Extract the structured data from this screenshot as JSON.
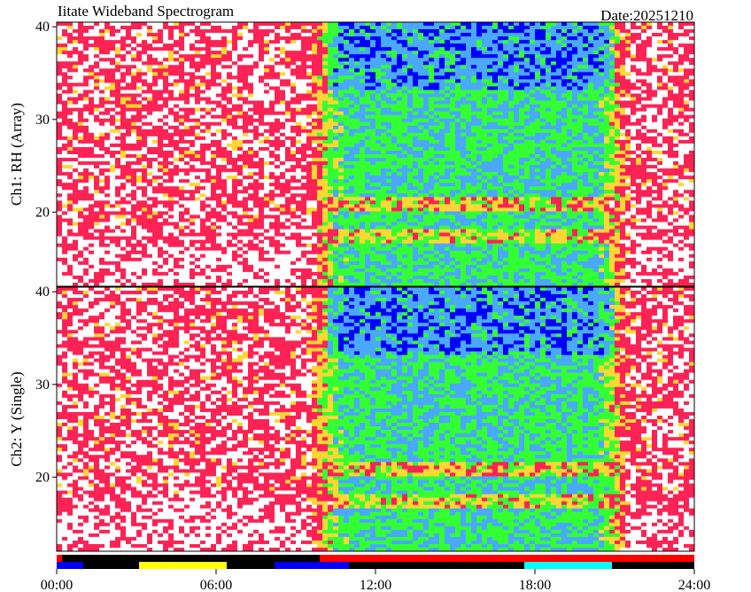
{
  "title": "Iitate Wideband Spectrogram",
  "date_label": "Date:20251210",
  "chart_data": [
    {
      "type": "heatmap",
      "ylabel": "Ch1: RH (Array)",
      "ylim": [
        12,
        40.5
      ],
      "y_ticks": [
        20,
        30,
        40
      ],
      "y_tick_labels": [
        "20",
        "30",
        "40"
      ],
      "x_ticks": [
        0,
        6,
        12,
        18,
        24
      ],
      "x_tick_labels": [
        "00:00",
        "06:00",
        "12:00",
        "18:00",
        "24:00"
      ],
      "xlim": [
        0,
        24
      ],
      "colors": {
        "low": "#0000ff",
        "mid_low": "#4aa8ff",
        "mid": "#33ff33",
        "mid_high": "#ffd633",
        "high": "#ff2255",
        "peak": "#ffffff"
      }
    },
    {
      "type": "heatmap",
      "ylabel": "Ch2: Y (Single)",
      "ylim": [
        12,
        40.5
      ],
      "y_ticks": [
        20,
        30,
        40
      ],
      "y_tick_labels": [
        "20",
        "30",
        "40"
      ],
      "x_ticks": [
        0,
        6,
        12,
        18,
        24
      ],
      "x_tick_labels": [
        "00:00",
        "06:00",
        "12:00",
        "18:00",
        "24:00"
      ],
      "xlim": [
        0,
        24
      ],
      "colors": {
        "low": "#0000ff",
        "mid_low": "#4aa8ff",
        "mid": "#33ff33",
        "mid_high": "#ffd633",
        "high": "#ff2255",
        "peak": "#ffffff"
      }
    }
  ],
  "status_bars": [
    {
      "segments": [
        {
          "start": 0,
          "end": 0.2,
          "color": "#ff0000"
        },
        {
          "start": 0.2,
          "end": 9.9,
          "color": "#000000"
        },
        {
          "start": 9.9,
          "end": 24,
          "color": "#ff0000"
        }
      ]
    },
    {
      "segments": [
        {
          "start": 0,
          "end": 1.0,
          "color": "#0000ff"
        },
        {
          "start": 1.0,
          "end": 3.1,
          "color": "#000000"
        },
        {
          "start": 3.1,
          "end": 6.4,
          "color": "#ffff00"
        },
        {
          "start": 6.4,
          "end": 8.2,
          "color": "#000000"
        },
        {
          "start": 8.2,
          "end": 11.0,
          "color": "#0000ff"
        },
        {
          "start": 11.0,
          "end": 17.6,
          "color": "#000000"
        },
        {
          "start": 17.6,
          "end": 20.9,
          "color": "#00ffff"
        },
        {
          "start": 20.9,
          "end": 24,
          "color": "#000000"
        }
      ]
    }
  ]
}
